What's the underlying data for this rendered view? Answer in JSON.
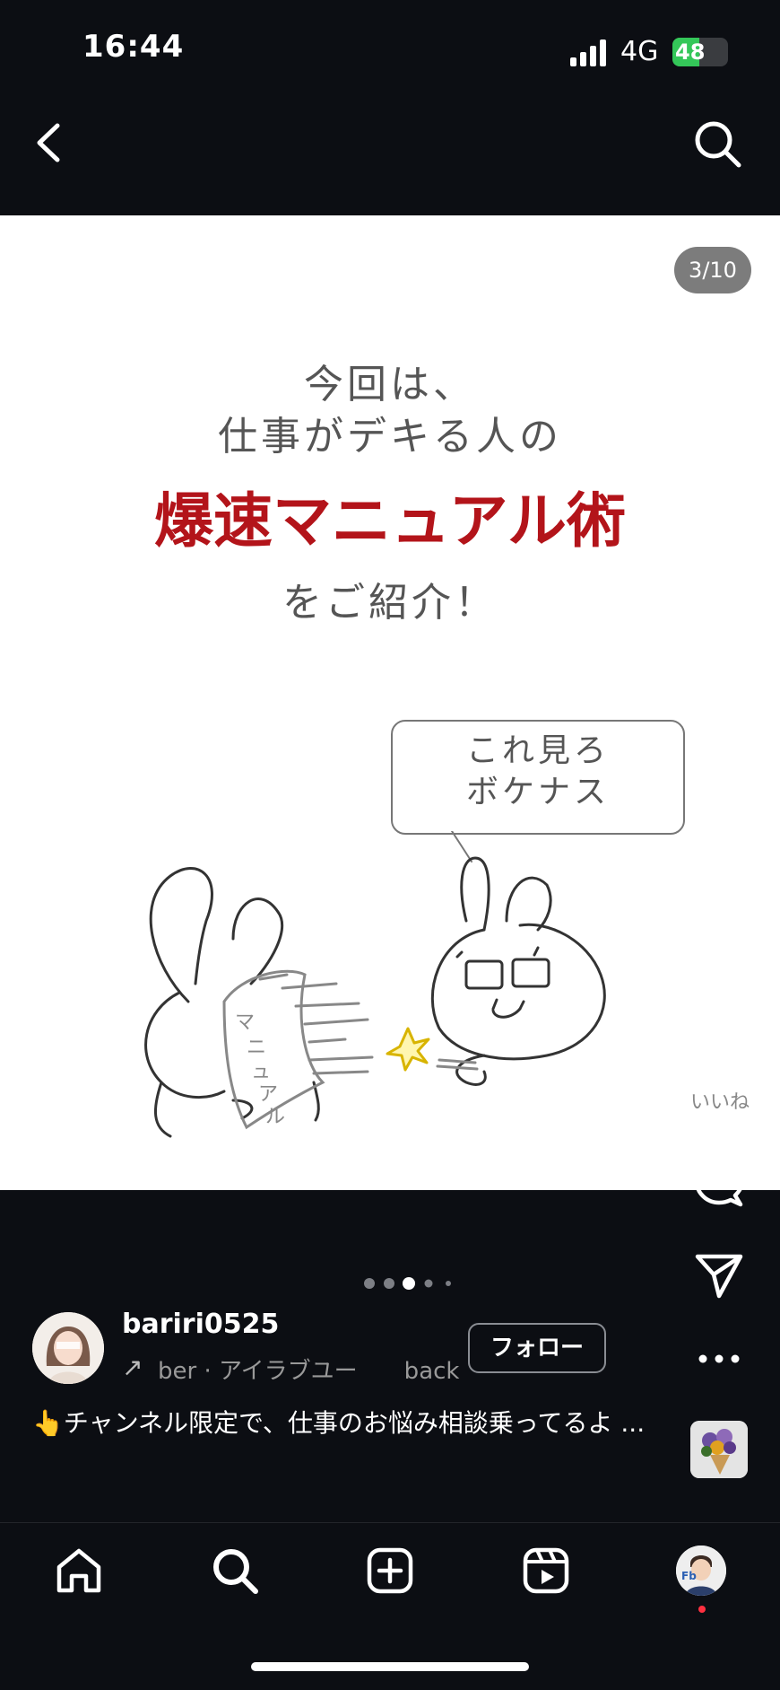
{
  "status_bar": {
    "time": "16:44",
    "network": "4G",
    "battery": "48",
    "battery_level": 0.48
  },
  "post": {
    "page_counter": "3/10",
    "text_line1": "今回は、",
    "text_line2": "仕事がデキる人の",
    "headline": "爆速マニュアル術",
    "text_line4": "をご紹介！",
    "speech_line1": "これ見ろ",
    "speech_line2": "ボケナス",
    "manual_label": "マニュアル",
    "carousel": {
      "total": 5,
      "active": 3
    }
  },
  "actions": {
    "like_label": "いいね"
  },
  "user": {
    "username": "bariri0525",
    "sub_text": "ber · アイラブユー　　back",
    "follow_label": "フォロー"
  },
  "caption": "👆チャンネル限定で、仕事のお悩み相談乗ってるよ ...",
  "colors": {
    "headline": "#b3141a",
    "background": "#0c0e13",
    "notification": "#ff3040"
  }
}
